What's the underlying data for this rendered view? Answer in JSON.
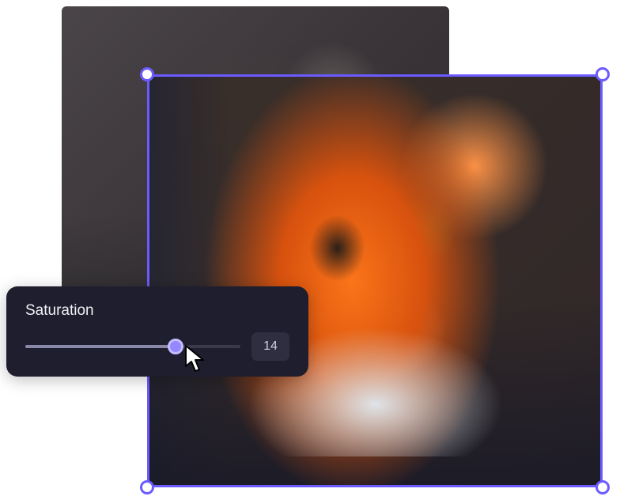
{
  "editor": {
    "selection": {
      "border_color": "#6b5bff",
      "handle_fill": "#ffffff"
    },
    "adjustment": {
      "label": "Saturation",
      "value": "14",
      "slider_percent": 70
    }
  }
}
